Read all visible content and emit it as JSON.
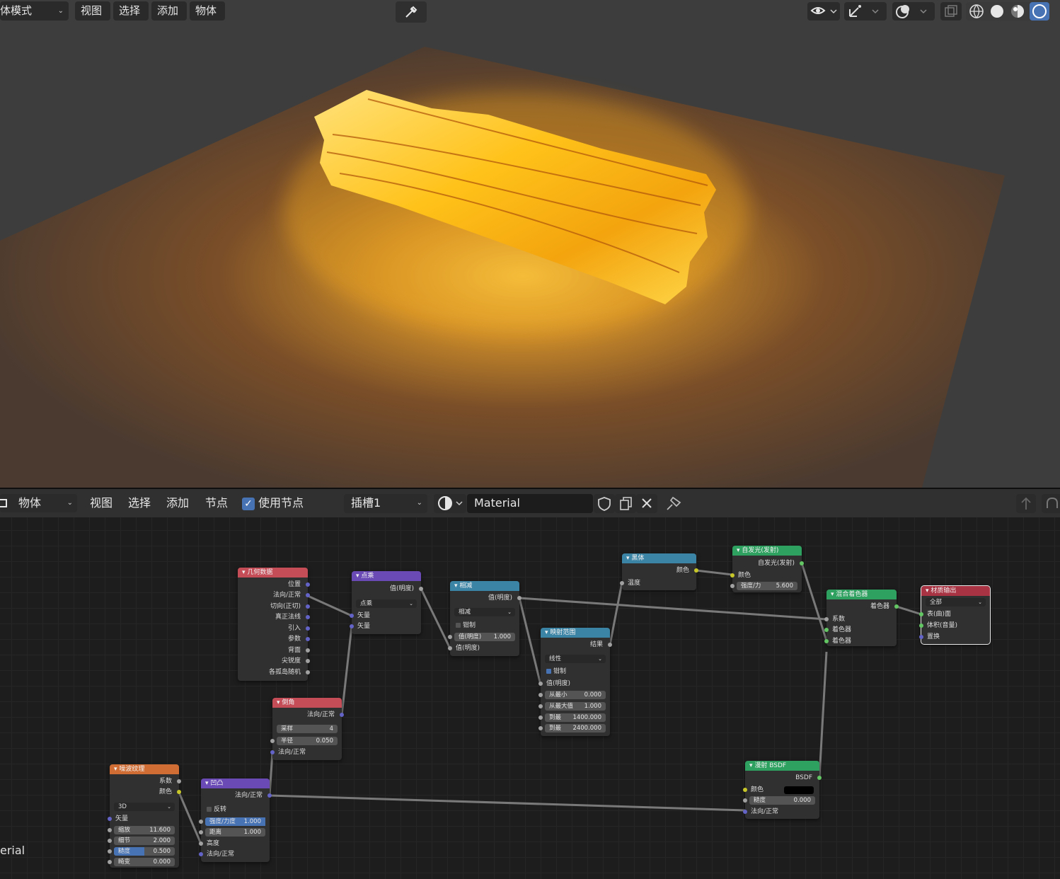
{
  "viewport_header": {
    "mode_label": "体模式",
    "menus": [
      "视图",
      "选择",
      "添加",
      "物体"
    ]
  },
  "viewport_icons": {
    "eyedropper": "eyedropper-icon",
    "visibility": "eye-icon",
    "gizmo": "gizmo-icon",
    "overlay": "overlay-icon",
    "xray": "xray-icon",
    "shading_modes": [
      "wireframe-icon",
      "solid-icon",
      "material-preview-icon",
      "rendered-icon"
    ]
  },
  "node_header": {
    "editor_type": "物体",
    "menus": [
      "视图",
      "选择",
      "添加",
      "节点"
    ],
    "use_nodes_label": "使用节点",
    "slot": "插槽1",
    "material_name": "Material"
  },
  "left_fragment": "erial",
  "colors": {
    "accent": "#4772b3",
    "header_input": "#c44d58",
    "header_texture": "#cf6d35",
    "header_converter": "#3c84a5",
    "header_vector": "#6a4ab5",
    "header_shader": "#2ea05f",
    "header_output": "#a83342",
    "socket_grey": "#a1a1a1",
    "socket_purple": "#6363c7",
    "socket_yellow": "#c7c729",
    "socket_green": "#63c763"
  },
  "nodes": {
    "geometry": {
      "title": "几何数据",
      "outputs": [
        "位置",
        "法向/正常",
        "切向(正切)",
        "真正法线",
        "引入",
        "参数",
        "背面",
        "尖锐度",
        "各孤岛随机"
      ]
    },
    "dot": {
      "title": "点乘",
      "output": "值(明度)",
      "op": "点乘",
      "inputs": [
        "矢量",
        "矢量"
      ]
    },
    "subtract": {
      "title": "相减",
      "output": "值(明度)",
      "op": "相减",
      "clamp": "钳制",
      "field_label": "值(明度)",
      "field_value": "1.000",
      "input": "值(明度)"
    },
    "map_range": {
      "title": "映射范围",
      "output": "结果",
      "mode": "线性",
      "clamp": "钳制",
      "input": "值(明度)",
      "fields": [
        {
          "label": "从最小",
          "value": "0.000"
        },
        {
          "label": "从最大值",
          "value": "1.000"
        },
        {
          "label": "到最",
          "value": "1400.000"
        },
        {
          "label": "到最",
          "value": "2400.000"
        }
      ]
    },
    "blackbody": {
      "title": "黑体",
      "output": "颜色",
      "input": "温度"
    },
    "emission": {
      "title": "自发光(发射)",
      "output": "自发光(发射)",
      "input_color": "颜色",
      "strength_label": "强度/力",
      "strength_value": "5.600"
    },
    "mix_shader": {
      "title": "混合着色器",
      "output": "着色器",
      "inputs": [
        "系数",
        "着色器",
        "着色器"
      ]
    },
    "material_output": {
      "title": "材质输出",
      "target": "全部",
      "inputs": [
        "表(曲)面",
        "体积(音量)",
        "置换"
      ]
    },
    "bevel": {
      "title": "倒角",
      "output": "法向/正常",
      "samples_label": "采样",
      "samples_value": "4",
      "radius_label": "半径",
      "radius_value": "0.050",
      "input": "法向/正常"
    },
    "noise": {
      "title": "噪波纹理",
      "outputs": [
        "系数",
        "颜色"
      ],
      "dim": "3D",
      "input": "矢量",
      "fields": [
        {
          "label": "缩放",
          "value": "11.600",
          "fill": 0
        },
        {
          "label": "细节",
          "value": "2.000",
          "fill": 0
        },
        {
          "label": "糙度",
          "value": "0.500",
          "fill": 0.5
        },
        {
          "label": "畸变",
          "value": "0.000",
          "fill": 0
        }
      ]
    },
    "bump": {
      "title": "凹凸",
      "output": "法向/正常",
      "invert": "反转",
      "strength_label": "强度/力度",
      "strength_value": "1.000",
      "strength_fill": 1,
      "distance_label": "距离",
      "distance_value": "1.000",
      "inputs": [
        "高度",
        "法向/正常"
      ]
    },
    "diffuse": {
      "title": "漫射 BSDF",
      "output": "BSDF",
      "input_color": "颜色",
      "roughness_label": "糙度",
      "roughness_value": "0.000",
      "input_normal": "法向/正常"
    }
  }
}
